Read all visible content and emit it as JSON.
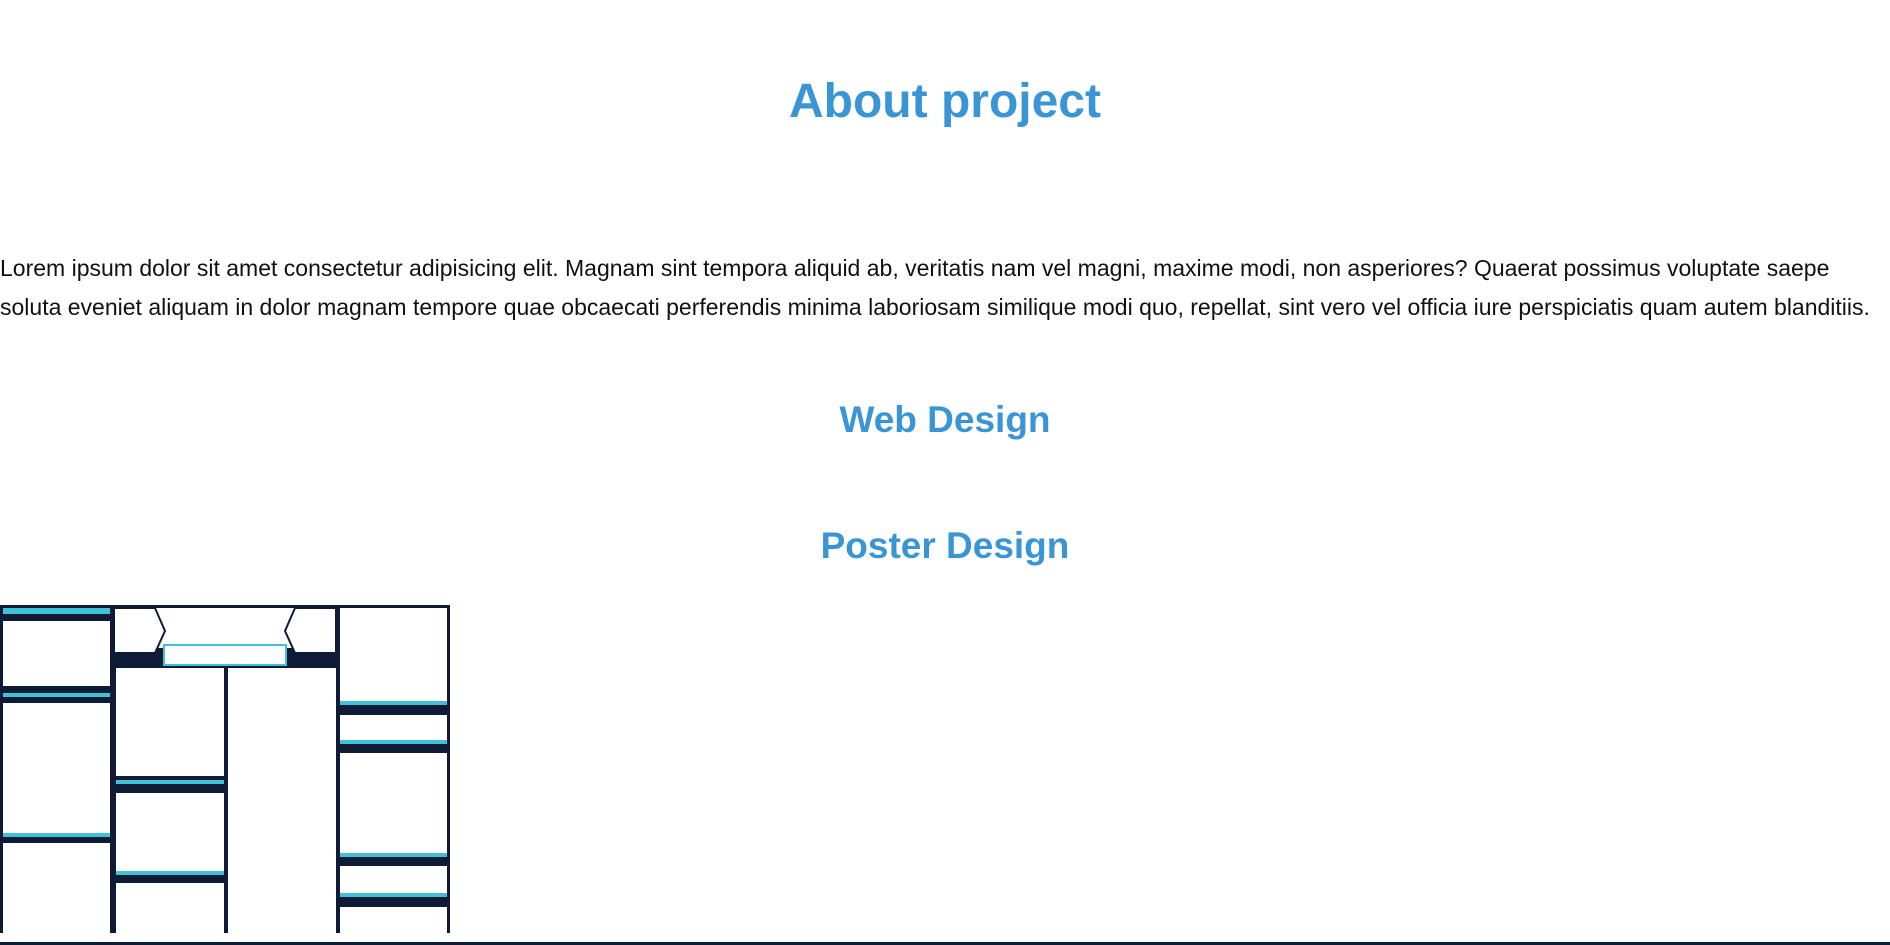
{
  "page": {
    "title": "About project",
    "description": "Lorem ipsum dolor sit amet consectetur adipisicing elit. Magnam sint tempora aliquid ab, veritatis nam vel magni, maxime modi, non asperiores? Quaerat possimus voluptate saepe soluta eveniet aliquam in dolor magnam tempore quae obcaecati perferendis minima laboriosam similique modi quo, repellat, sint vero vel officia iure perspiciatis quam autem blanditiis."
  },
  "sections": {
    "web_design": {
      "heading": "Web Design"
    },
    "poster_design": {
      "heading": "Poster Design"
    }
  },
  "colors": {
    "accent": "#3a95d5",
    "text": "#111111",
    "navy": "#0d1b36",
    "cyan": "#3fc1d6",
    "background": "#ffffff"
  }
}
